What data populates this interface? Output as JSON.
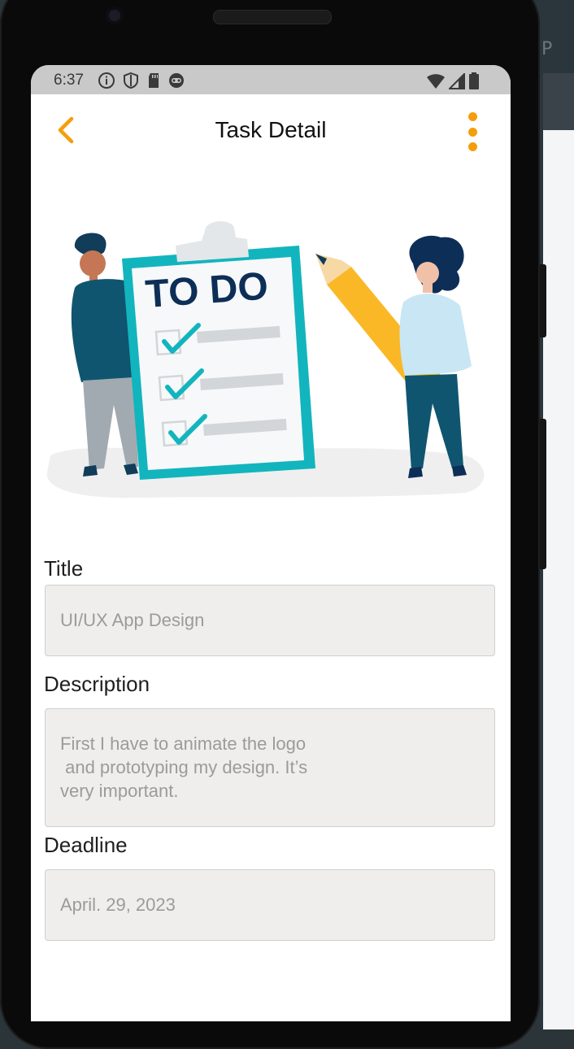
{
  "desktop": {
    "fragment": "'P"
  },
  "status_bar": {
    "time": "6:37"
  },
  "app_bar": {
    "title": "Task Detail"
  },
  "illustration": {
    "heading": "TO DO"
  },
  "form": {
    "title_label": "Title",
    "title_value": "UI/UX App Design",
    "description_label": "Description",
    "description_value": "First I have to animate the logo\n and prototyping my design. It’s\nvery important.",
    "deadline_label": "Deadline",
    "deadline_value": "April. 29, 2023"
  },
  "colors": {
    "accent": "#f59e0b",
    "clipboard": "#11b8c0",
    "field_bg": "#efeeed",
    "statusbar_bg": "#c9c9c9"
  }
}
